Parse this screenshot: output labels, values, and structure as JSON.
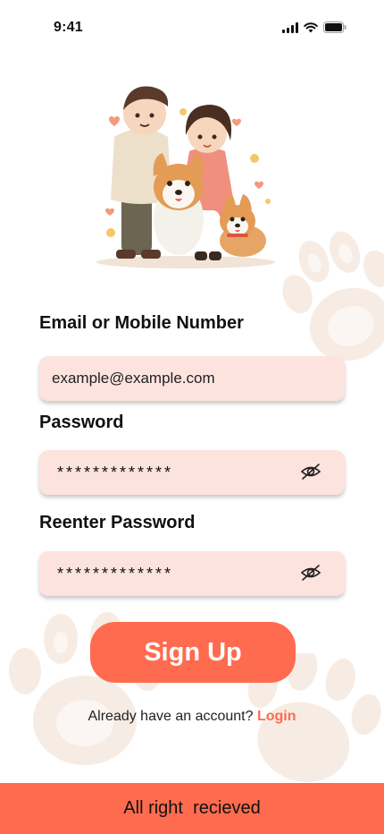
{
  "status_bar": {
    "time": "9:41",
    "icons": [
      "signal-icon",
      "wifi-icon",
      "battery-icon"
    ]
  },
  "illustration": {
    "description_icon": "couple-with-dogs-illustration"
  },
  "form": {
    "email": {
      "label": "Email or Mobile Number",
      "value": "example@example.com"
    },
    "password": {
      "label": "Password",
      "value": "*************",
      "toggle_icon": "eye-slash-icon"
    },
    "reenter_password": {
      "label": "Reenter Password",
      "value": "*************",
      "toggle_icon": "eye-slash-icon"
    }
  },
  "signup_button": {
    "label": "Sign Up"
  },
  "login_prompt": {
    "text": "Already have an account? ",
    "link": "Login"
  },
  "footer": {
    "text": "All right  recieved"
  },
  "colors": {
    "accent": "#ff6b4f",
    "input_bg": "#fde3de",
    "paw": "#f7ece4"
  }
}
